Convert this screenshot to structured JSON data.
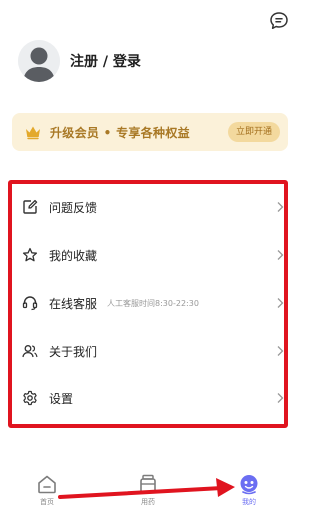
{
  "header": {
    "chat_icon": "chat-bubble-icon"
  },
  "profile": {
    "login_label": "注册 / 登录"
  },
  "vip": {
    "text": "升级会员 • 专享各种权益",
    "button": "立即开通",
    "icon": "crown-icon"
  },
  "menu": [
    {
      "label": "问题反馈",
      "icon": "edit-icon"
    },
    {
      "label": "我的收藏",
      "icon": "star-icon"
    },
    {
      "label": "在线客服",
      "sub": "人工客服时间8:30-22:30",
      "icon": "headset-icon"
    },
    {
      "label": "关于我们",
      "icon": "users-icon"
    },
    {
      "label": "设置",
      "icon": "gear-icon"
    }
  ],
  "tabs": [
    {
      "label": "首页",
      "icon": "home-icon"
    },
    {
      "label": "用药",
      "icon": "medicine-icon"
    },
    {
      "label": "我的",
      "icon": "profile-icon"
    }
  ],
  "colors": {
    "accent": "#6b6ef2",
    "highlight": "#e0141f",
    "vip_bg": "#fbf1d9",
    "vip_text": "#a97926"
  }
}
